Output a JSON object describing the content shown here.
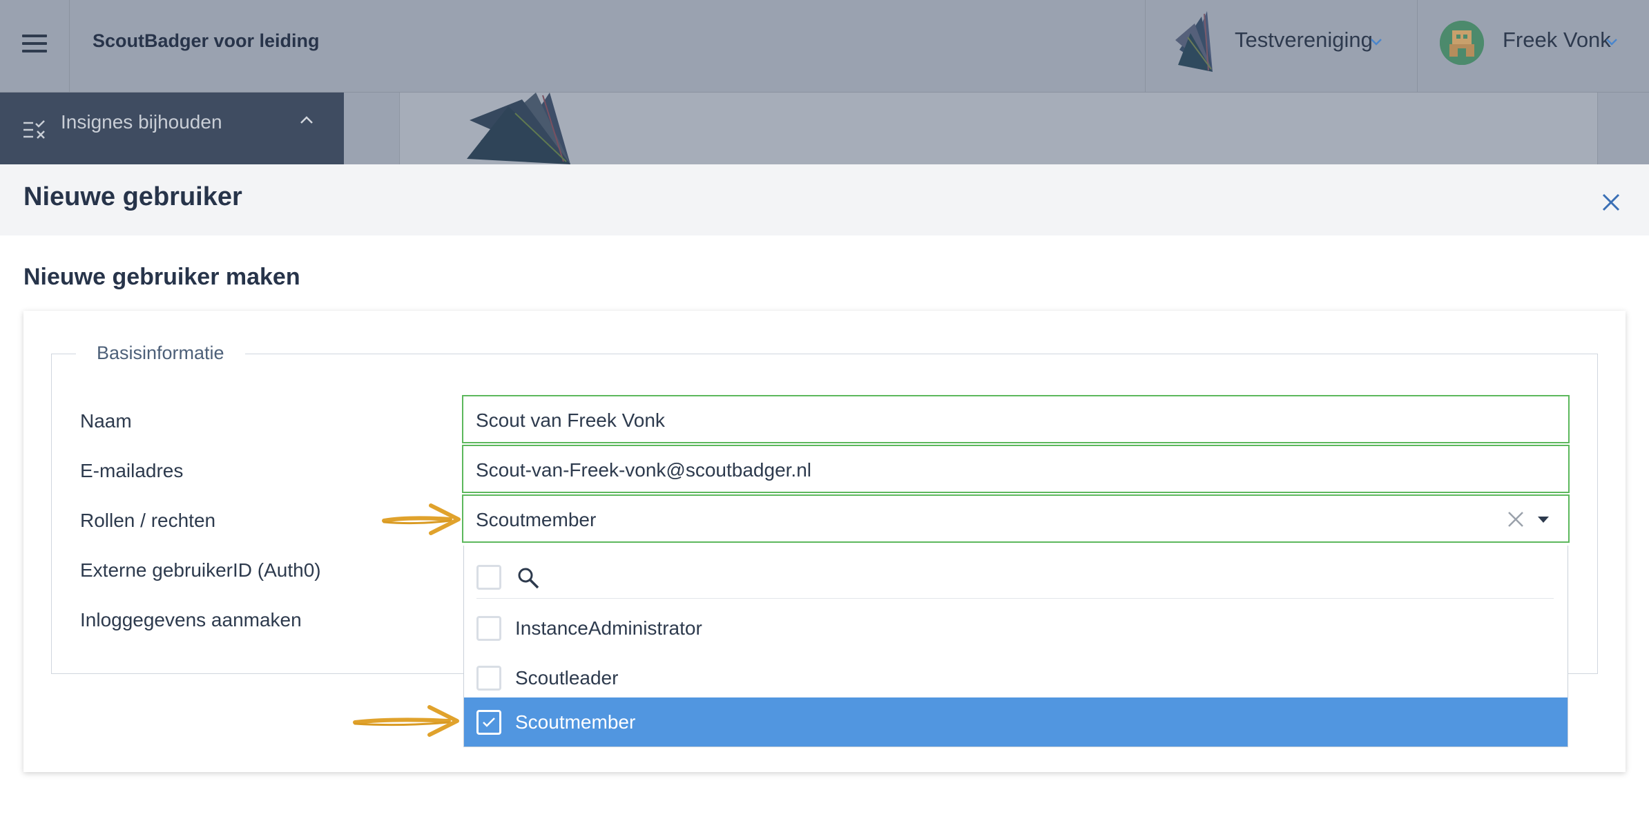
{
  "topbar": {
    "app_title": "ScoutBadger voor leiding",
    "organization": "Testvereniging",
    "user": "Freek Vonk"
  },
  "sidebar": {
    "active_item": "Insignes bijhouden"
  },
  "modal": {
    "title": "Nieuwe gebruiker",
    "section_title": "Nieuwe gebruiker maken",
    "fieldset_legend": "Basisinformatie",
    "fields": {
      "name": {
        "label": "Naam",
        "value": "Scout van Freek Vonk"
      },
      "email": {
        "label": "E-mailadres",
        "value": "Scout-van-Freek-vonk@scoutbadger.nl"
      },
      "roles": {
        "label": "Rollen / rechten",
        "value": "Scoutmember"
      },
      "external_id": {
        "label": "Externe gebruikerID (Auth0)"
      },
      "create_login": {
        "label": "Inloggegevens aanmaken"
      }
    },
    "roles_dropdown": {
      "options": [
        {
          "label": "InstanceAdministrator",
          "selected": false
        },
        {
          "label": "Scoutleader",
          "selected": false
        },
        {
          "label": "Scoutmember",
          "selected": true
        }
      ]
    }
  },
  "colors": {
    "topbar_overlay": "#9aa2b0",
    "sidebar_active": "#3f4c61",
    "valid_border": "#5cb85c",
    "selected_option": "#5196e0",
    "annotation_arrow": "#e0a22c"
  }
}
